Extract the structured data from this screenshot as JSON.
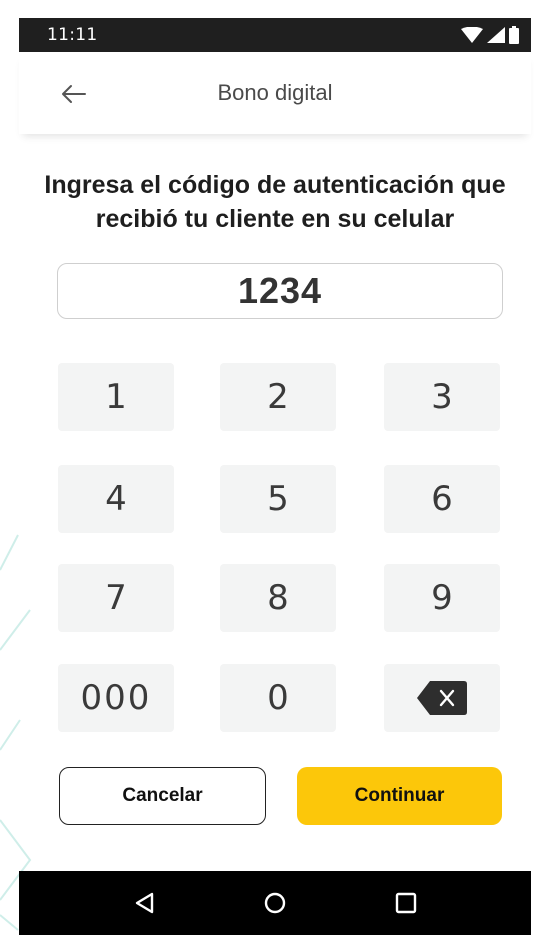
{
  "status_bar": {
    "time": "11:11"
  },
  "app_bar": {
    "title": "Bono digital"
  },
  "instruction": "Ingresa el código de autenticación que recibió tu cliente en su celular",
  "code_field": {
    "value": "1234"
  },
  "keypad": {
    "k1": "1",
    "k2": "2",
    "k3": "3",
    "k4": "4",
    "k5": "5",
    "k6": "6",
    "k7": "7",
    "k8": "8",
    "k9": "9",
    "k000": "000",
    "k0": "0"
  },
  "buttons": {
    "cancel": "Cancelar",
    "continue": "Continuar"
  },
  "colors": {
    "accent": "#fcc70a",
    "key_bg": "#f3f4f4",
    "decor": "#cfeee9"
  },
  "icons": [
    "back-arrow-icon",
    "wifi-icon",
    "signal-icon",
    "battery-icon",
    "backspace-icon",
    "nav-back-icon",
    "nav-home-icon",
    "nav-recents-icon"
  ]
}
